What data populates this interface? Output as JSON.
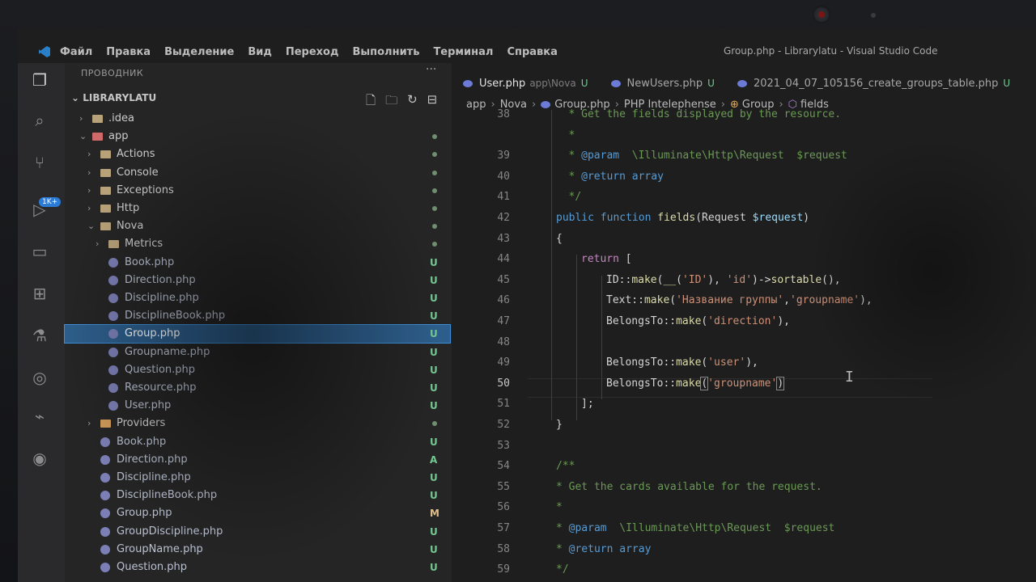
{
  "menu": {
    "items": [
      "Файл",
      "Правка",
      "Выделение",
      "Вид",
      "Переход",
      "Выполнить",
      "Терминал",
      "Справка"
    ],
    "window_title": "Group.php - Librarylatu - Visual Studio Code"
  },
  "activity_badge": "1K+",
  "sidebar": {
    "title": "ПРОВОДНИК",
    "more": "···",
    "root": "LIBRARYLATU",
    "rows": [
      {
        "label": ".idea",
        "type": "folder",
        "chev": "›",
        "depth": 1,
        "status": ""
      },
      {
        "label": "app",
        "type": "folder-red",
        "chev": "⌄",
        "depth": 1,
        "status": "dot"
      },
      {
        "label": "Actions",
        "type": "folder",
        "chev": "›",
        "depth": 2,
        "status": "dot"
      },
      {
        "label": "Console",
        "type": "folder",
        "chev": "›",
        "depth": 2,
        "status": "dot"
      },
      {
        "label": "Exceptions",
        "type": "folder",
        "chev": "›",
        "depth": 2,
        "status": "dot"
      },
      {
        "label": "Http",
        "type": "folder",
        "chev": "›",
        "depth": 2,
        "status": "dot"
      },
      {
        "label": "Nova",
        "type": "folder",
        "chev": "⌄",
        "depth": 2,
        "status": "dot"
      },
      {
        "label": "Metrics",
        "type": "folder",
        "chev": "›",
        "depth": 3,
        "status": "dot"
      },
      {
        "label": "Book.php",
        "type": "php",
        "chev": "",
        "depth": 3,
        "status": "U"
      },
      {
        "label": "Direction.php",
        "type": "php",
        "chev": "",
        "depth": 3,
        "status": "U"
      },
      {
        "label": "Discipline.php",
        "type": "php",
        "chev": "",
        "depth": 3,
        "status": "U"
      },
      {
        "label": "DisciplineBook.php",
        "type": "php",
        "chev": "",
        "depth": 3,
        "status": "U"
      },
      {
        "label": "Group.php",
        "type": "php",
        "chev": "",
        "depth": 3,
        "status": "U",
        "selected": true
      },
      {
        "label": "Groupname.php",
        "type": "php",
        "chev": "",
        "depth": 3,
        "status": "U"
      },
      {
        "label": "Question.php",
        "type": "php",
        "chev": "",
        "depth": 3,
        "status": "U"
      },
      {
        "label": "Resource.php",
        "type": "php",
        "chev": "",
        "depth": 3,
        "status": "U"
      },
      {
        "label": "User.php",
        "type": "php",
        "chev": "",
        "depth": 3,
        "status": "U"
      },
      {
        "label": "Providers",
        "type": "folder-orange",
        "chev": "›",
        "depth": 2,
        "status": "dot"
      },
      {
        "label": "Book.php",
        "type": "php",
        "chev": "",
        "depth": 2,
        "status": "U"
      },
      {
        "label": "Direction.php",
        "type": "php",
        "chev": "",
        "depth": 2,
        "status": "A"
      },
      {
        "label": "Discipline.php",
        "type": "php",
        "chev": "",
        "depth": 2,
        "status": "U"
      },
      {
        "label": "DisciplineBook.php",
        "type": "php",
        "chev": "",
        "depth": 2,
        "status": "U"
      },
      {
        "label": "Group.php",
        "type": "php",
        "chev": "",
        "depth": 2,
        "status": "M"
      },
      {
        "label": "GroupDiscipline.php",
        "type": "php",
        "chev": "",
        "depth": 2,
        "status": "U"
      },
      {
        "label": "GroupName.php",
        "type": "php",
        "chev": "",
        "depth": 2,
        "status": "U"
      },
      {
        "label": "Question.php",
        "type": "php",
        "chev": "",
        "depth": 2,
        "status": "U"
      }
    ]
  },
  "tabs": [
    {
      "name": "User.php",
      "path": "app\\Nova",
      "status": "U",
      "active": true
    },
    {
      "name": "NewUsers.php",
      "path": "",
      "status": "U",
      "active": false
    },
    {
      "name": "2021_04_07_105156_create_groups_table.php",
      "path": "",
      "status": "U",
      "active": false
    }
  ],
  "breadcrumb": [
    "app",
    "Nova",
    "Group.php",
    "PHP Intelephense",
    "Group",
    "fields"
  ],
  "code": {
    "current_line": 50,
    "lines": [
      {
        "n": "38",
        "indent": 3,
        "parts": [
          [
            "cm",
            "* Get the fields displayed by the resource."
          ]
        ]
      },
      {
        "n": "",
        "indent": 3,
        "parts": [
          [
            "cm",
            "*"
          ]
        ]
      },
      {
        "n": "39",
        "indent": 3,
        "parts": [
          [
            "cm",
            "* "
          ],
          [
            "tag",
            "@param"
          ],
          [
            "cm",
            "  \\Illuminate\\Http\\Request  $request"
          ]
        ]
      },
      {
        "n": "40",
        "indent": 3,
        "parts": [
          [
            "cm",
            "* "
          ],
          [
            "tag",
            "@return"
          ],
          [
            "cm",
            " "
          ],
          [
            "kw",
            "array"
          ]
        ]
      },
      {
        "n": "41",
        "indent": 3,
        "parts": [
          [
            "cm",
            "*/"
          ]
        ]
      },
      {
        "n": "42",
        "indent": 2,
        "parts": [
          [
            "kw",
            "public"
          ],
          [
            "p",
            " "
          ],
          [
            "kw",
            "function"
          ],
          [
            "p",
            " "
          ],
          [
            "fn",
            "fields"
          ],
          [
            "p",
            "(Request "
          ],
          [
            "var",
            "$request"
          ],
          [
            "p",
            ")"
          ]
        ]
      },
      {
        "n": "43",
        "indent": 2,
        "parts": [
          [
            "p",
            "{"
          ]
        ]
      },
      {
        "n": "44",
        "indent": 4,
        "parts": [
          [
            "kw2",
            "return"
          ],
          [
            "p",
            " ["
          ]
        ]
      },
      {
        "n": "45",
        "indent": 6,
        "parts": [
          [
            "p",
            "ID::"
          ],
          [
            "fn",
            "make"
          ],
          [
            "p",
            "("
          ],
          [
            "fn",
            "__"
          ],
          [
            "p",
            "("
          ],
          [
            "str",
            "'ID'"
          ],
          [
            "p",
            "), "
          ],
          [
            "str",
            "'id'"
          ],
          [
            "p",
            ")->"
          ],
          [
            "fn",
            "sortable"
          ],
          [
            "p",
            "(),"
          ]
        ]
      },
      {
        "n": "46",
        "indent": 6,
        "parts": [
          [
            "p",
            "Text::"
          ],
          [
            "fn",
            "make"
          ],
          [
            "p",
            "("
          ],
          [
            "str",
            "'Название группы'"
          ],
          [
            "p",
            ","
          ],
          [
            "str",
            "'groupname'"
          ],
          [
            "p",
            "),"
          ]
        ]
      },
      {
        "n": "47",
        "indent": 6,
        "parts": [
          [
            "p",
            "BelongsTo::"
          ],
          [
            "fn",
            "make"
          ],
          [
            "p",
            "("
          ],
          [
            "str",
            "'direction'"
          ],
          [
            "p",
            "),"
          ]
        ]
      },
      {
        "n": "48",
        "indent": 6,
        "parts": []
      },
      {
        "n": "49",
        "indent": 6,
        "parts": [
          [
            "p",
            "BelongsTo::"
          ],
          [
            "fn",
            "make"
          ],
          [
            "p",
            "("
          ],
          [
            "str",
            "'user'"
          ],
          [
            "p",
            "),"
          ]
        ]
      },
      {
        "n": "50",
        "indent": 6,
        "parts": [
          [
            "p",
            "BelongsTo::"
          ],
          [
            "fn",
            "make"
          ],
          [
            "pb",
            "("
          ],
          [
            "str",
            "'groupname'"
          ],
          [
            "pb",
            ")"
          ]
        ]
      },
      {
        "n": "51",
        "indent": 4,
        "parts": [
          [
            "p",
            "];"
          ]
        ]
      },
      {
        "n": "52",
        "indent": 2,
        "parts": [
          [
            "p",
            "}"
          ]
        ]
      },
      {
        "n": "53",
        "indent": 2,
        "parts": []
      },
      {
        "n": "54",
        "indent": 2,
        "parts": [
          [
            "cm",
            "/**"
          ]
        ]
      },
      {
        "n": "55",
        "indent": 2,
        "parts": [
          [
            "cm",
            "* Get the cards available for the request."
          ]
        ]
      },
      {
        "n": "56",
        "indent": 2,
        "parts": [
          [
            "cm",
            "*"
          ]
        ]
      },
      {
        "n": "57",
        "indent": 2,
        "parts": [
          [
            "cm",
            "* "
          ],
          [
            "tag",
            "@param"
          ],
          [
            "cm",
            "  \\Illuminate\\Http\\Request  $request"
          ]
        ]
      },
      {
        "n": "58",
        "indent": 2,
        "parts": [
          [
            "cm",
            "* "
          ],
          [
            "tag",
            "@return"
          ],
          [
            "cm",
            " "
          ],
          [
            "kw",
            "array"
          ]
        ]
      },
      {
        "n": "59",
        "indent": 2,
        "parts": [
          [
            "cm",
            "*/"
          ]
        ]
      }
    ]
  }
}
